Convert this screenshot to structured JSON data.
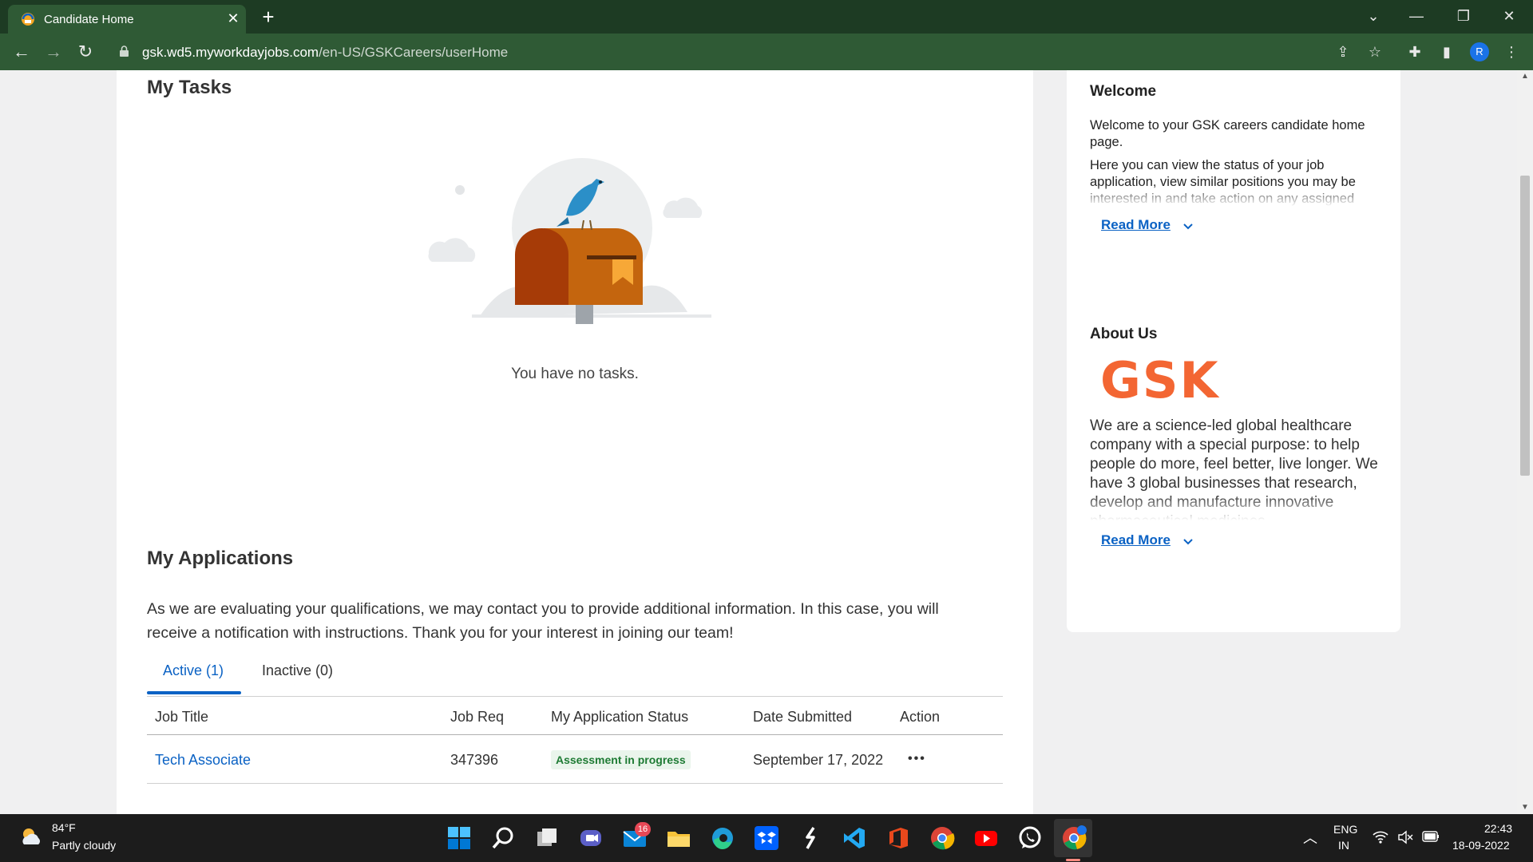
{
  "browser": {
    "tab_title": "Candidate Home",
    "url_host": "gsk.wd5.myworkdayjobs.com",
    "url_path": "/en-US/GSKCareers/userHome",
    "profile_initial": "R"
  },
  "tasks": {
    "heading": "My Tasks",
    "empty_message": "You have no tasks."
  },
  "applications": {
    "heading": "My Applications",
    "description": "As we are evaluating your qualifications, we may contact you to provide additional information. In this case, you will receive a notification with instructions. Thank you for your interest in joining our team!",
    "tabs": [
      {
        "label": "Active (1)",
        "selected": true
      },
      {
        "label": "Inactive (0)",
        "selected": false
      }
    ],
    "columns": [
      "Job Title",
      "Job Req",
      "My Application Status",
      "Date Submitted",
      "Action"
    ],
    "rows": [
      {
        "job_title": "Tech Associate",
        "job_req": "347396",
        "status": "Assessment in progress",
        "date_submitted": "September 17, 2022",
        "action": "•••"
      }
    ]
  },
  "sidebar": {
    "welcome": {
      "heading": "Welcome",
      "intro": "Welcome to your GSK careers candidate home page.",
      "body": "Here you can view the status of your job application, view similar positions you may be interested in and take action on any assigned tasks we send you.",
      "read_more": "Read More"
    },
    "about": {
      "heading": "About Us",
      "logo_text": "GSK",
      "body": "We are a science-led global healthcare company with a special purpose: to help people do more, feel better, live longer. We have 3 global businesses that research, develop and manufacture innovative pharmaceutical medicines,",
      "read_more": "Read More"
    }
  },
  "taskbar": {
    "weather_temp": "84°F",
    "weather_desc": "Partly cloudy",
    "mail_badge": "16",
    "lang_top": "ENG",
    "lang_bottom": "IN",
    "time": "22:43",
    "date": "18-09-2022"
  },
  "colors": {
    "browser_frame": "#1d3b23",
    "browser_toolbar": "#2f5a35",
    "link_blue": "#0b62c4",
    "status_green": "#1e7b34",
    "gsk_orange": "#f36633"
  }
}
